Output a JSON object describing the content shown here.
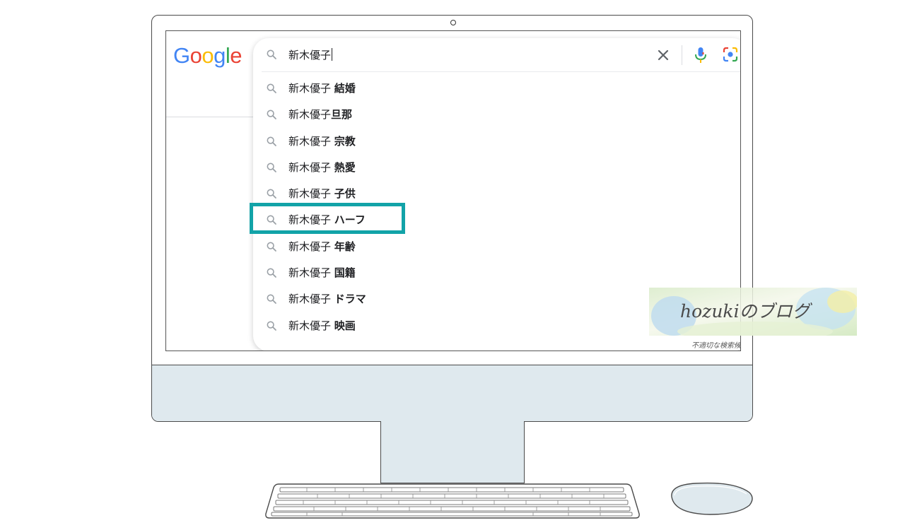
{
  "search": {
    "query": "新木優子",
    "suggestion_base": "新木優子"
  },
  "suggestions": [
    {
      "suffix": "結婚"
    },
    {
      "suffix": "旦那",
      "no_space": true
    },
    {
      "suffix": "宗教"
    },
    {
      "suffix": "熱愛"
    },
    {
      "suffix": "子供"
    },
    {
      "suffix": "ハーフ"
    },
    {
      "suffix": "年齢"
    },
    {
      "suffix": "国籍"
    },
    {
      "suffix": "ドラマ"
    },
    {
      "suffix": "映画"
    }
  ],
  "report_link": "不適切な検索候補",
  "watermark": {
    "text": "hozukiのブログ"
  },
  "logo": {
    "letters": [
      "G",
      "o",
      "o",
      "g",
      "l",
      "e"
    ]
  },
  "colors": {
    "google_blue": "#4285F4",
    "google_red": "#EA4335",
    "google_yellow": "#FBBC05",
    "google_green": "#34A853",
    "highlight": "#12a3a8",
    "monitor_fill": "#dfe9ee"
  },
  "icons": [
    "search-icon",
    "clear-icon",
    "mic-icon",
    "lens-icon"
  ]
}
